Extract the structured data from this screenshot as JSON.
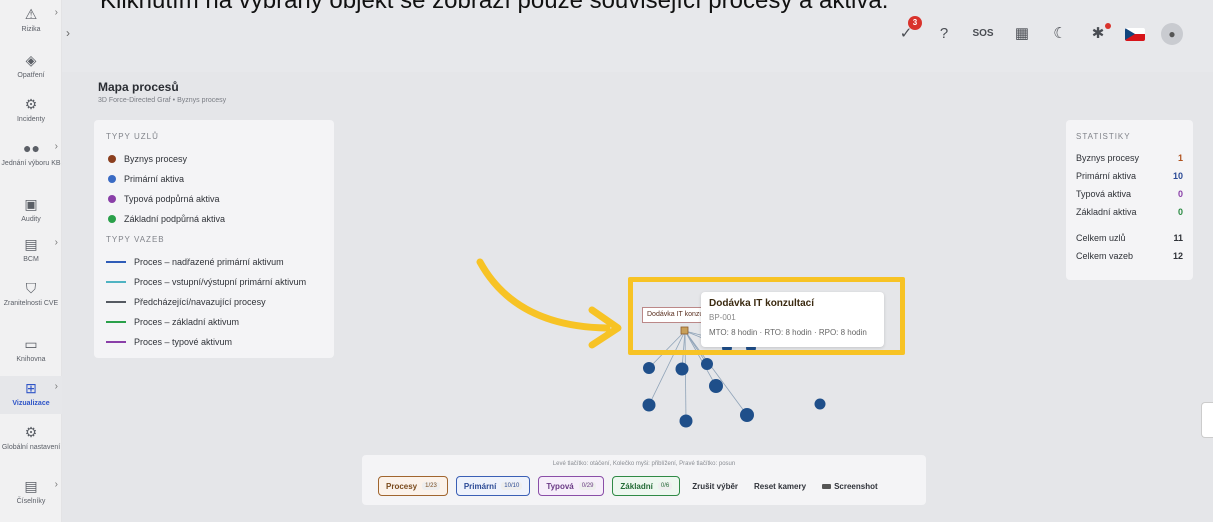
{
  "caption": "Kliknutím na vybraný objekt se zobrazí pouze související procesy a aktiva.",
  "sidebar": {
    "items": [
      {
        "label": "Rizika",
        "icon": "warning-triangle-icon",
        "glyph": "⚠",
        "chevron": true
      },
      {
        "label": "Opatření",
        "icon": "shield-check-icon",
        "glyph": "◈",
        "chevron": false
      },
      {
        "label": "Incidenty",
        "icon": "bug-icon",
        "glyph": "⚙",
        "chevron": false
      },
      {
        "label": "Jednání výboru KB",
        "icon": "users-icon",
        "glyph": "👥",
        "chevron": true
      },
      {
        "label": "Audity",
        "icon": "briefcase-icon",
        "glyph": "▣",
        "chevron": false
      },
      {
        "label": "BCM",
        "icon": "clipboard-icon",
        "glyph": "▤",
        "chevron": true
      },
      {
        "label": "Zranitelnosti CVE",
        "icon": "shield-alert-icon",
        "glyph": "⛉",
        "chevron": false
      },
      {
        "label": "Knihovna",
        "icon": "folder-icon",
        "glyph": "▭",
        "chevron": false
      },
      {
        "label": "Vizualizace",
        "icon": "sitemap-icon",
        "glyph": "⊞",
        "chevron": true,
        "active": true
      },
      {
        "label": "Globální nastavení",
        "icon": "settings-gear-icon",
        "glyph": "⚙",
        "chevron": false
      },
      {
        "label": "Číselníky",
        "icon": "list-box-icon",
        "glyph": "▤",
        "chevron": true
      }
    ]
  },
  "topbar": {
    "tasks_badge": "3",
    "sos_label": "SOS"
  },
  "page": {
    "title": "Mapa procesů",
    "subtitle": "3D Force-Directed Graf • Byznys procesy"
  },
  "legend": {
    "node_types_title": "TYPY UZLŮ",
    "node_types": [
      {
        "label": "Byznys procesy",
        "color": "#8b3f1f"
      },
      {
        "label": "Primární aktiva",
        "color": "#3a6bc4"
      },
      {
        "label": "Typová podpůrná aktiva",
        "color": "#8a3fa8"
      },
      {
        "label": "Základní podpůrná aktiva",
        "color": "#2aa04a"
      }
    ],
    "edge_types_title": "TYPY VAZEB",
    "edge_types": [
      {
        "label": "Proces – nadřazené primární aktivum",
        "color": "#2f5cb8"
      },
      {
        "label": "Proces – vstupní/výstupní primární aktivum",
        "color": "#4fb3c2"
      },
      {
        "label": "Předcházející/navazující procesy",
        "color": "#555a62"
      },
      {
        "label": "Proces – základní aktivum",
        "color": "#2aa04a"
      },
      {
        "label": "Proces – typové aktivum",
        "color": "#8a3fa8"
      }
    ]
  },
  "stats": {
    "title": "STATISTIKY",
    "rows": [
      {
        "label": "Byznys procesy",
        "value": "1",
        "color": "#b0521e"
      },
      {
        "label": "Primární aktiva",
        "value": "10",
        "color": "#2b4a96"
      },
      {
        "label": "Typová aktiva",
        "value": "0",
        "color": "#8a3fa8"
      },
      {
        "label": "Základní aktiva",
        "value": "0",
        "color": "#2a8a42"
      }
    ],
    "total_nodes_label": "Celkem uzlů",
    "total_nodes": "11",
    "total_edges_label": "Celkem vazeb",
    "total_edges": "12"
  },
  "tooltip": {
    "title": "Dodávka IT konzultací",
    "id": "BP-001",
    "meta": "MTO: 8 hodin · RTO: 8 hodin · RPO: 8 hodin"
  },
  "node_label": "Dodávka IT konzultací",
  "bottombar": {
    "hint": "Levé tlačítko: otáčení, Kolečko myši: přiblížení, Pravé tlačítko: posun",
    "filters": [
      {
        "label": "Procesy",
        "count": "1/23",
        "kind": "proc"
      },
      {
        "label": "Primární",
        "count": "10/10",
        "kind": "prim"
      },
      {
        "label": "Typová",
        "count": "0/29",
        "kind": "typ"
      },
      {
        "label": "Základní",
        "count": "0/6",
        "kind": "zak"
      }
    ],
    "clear_label": "Zrušit výběr",
    "reset_label": "Reset kamery",
    "screenshot_label": "Screenshot"
  }
}
